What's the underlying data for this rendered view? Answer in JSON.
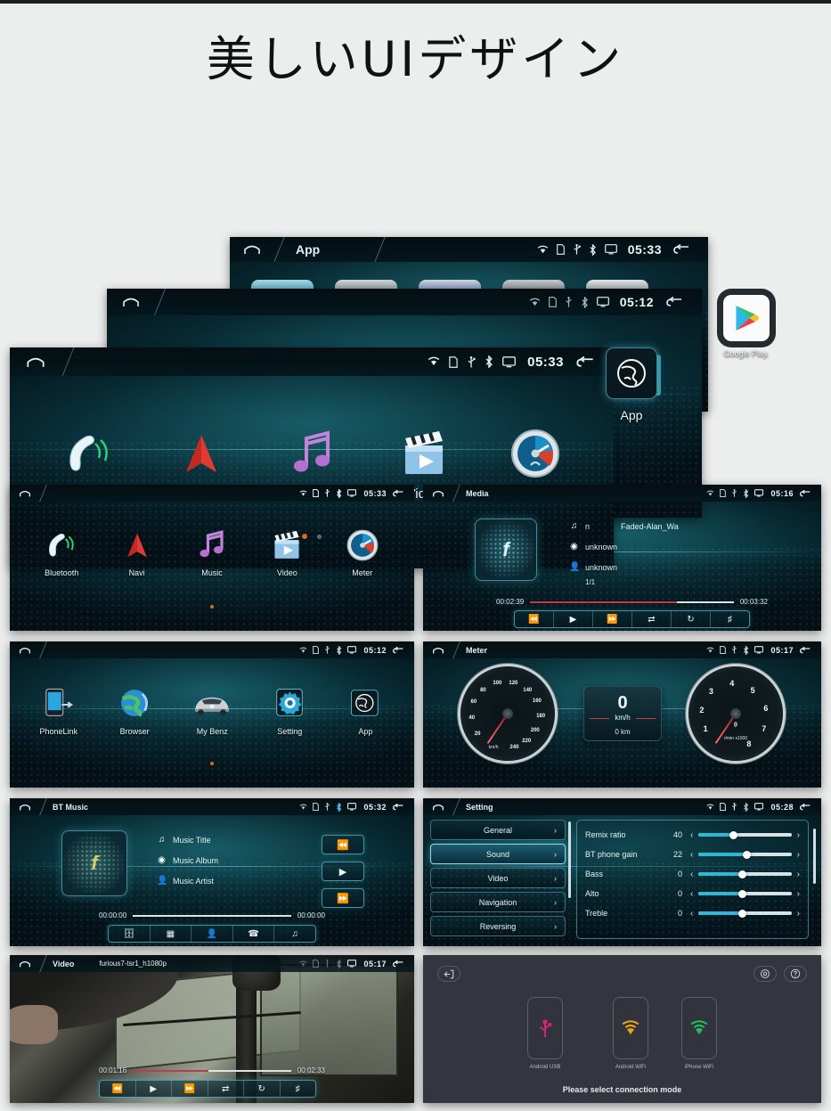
{
  "page": {
    "title": "美しいUIデザイン",
    "background": "#eceded"
  },
  "status_icons": [
    "wifi-icon",
    "sim-card-icon",
    "usb-icon",
    "bluetooth-icon",
    "display-icon"
  ],
  "hero": {
    "app_screen": {
      "title": "App",
      "time": "05:33",
      "google_play_label": "Google Play.",
      "home_icon": "home-icon",
      "back_icon": "back-arrow-icon"
    },
    "menu2_screen": {
      "title": "",
      "time": "05:12",
      "app_label": "App",
      "app_icon": "globe-icon"
    },
    "main_screen": {
      "title": "",
      "time": "05:33",
      "apps": [
        {
          "label": "Bluetooth",
          "icon": "bluetooth-phone-icon"
        },
        {
          "label": "Navi",
          "icon": "navigation-arrow-icon"
        },
        {
          "label": "Music",
          "icon": "music-note-icon"
        },
        {
          "label": "Video",
          "icon": "clapperboard-play-icon"
        },
        {
          "label": "Meter",
          "icon": "gauge-meter-icon"
        }
      ],
      "dots": [
        "on",
        "off"
      ]
    }
  },
  "panels": {
    "home1": {
      "title": "",
      "time": "05:33",
      "apps": [
        {
          "label": "Bluetooth",
          "icon": "bluetooth-phone-icon"
        },
        {
          "label": "Navi",
          "icon": "navigation-arrow-icon"
        },
        {
          "label": "Music",
          "icon": "music-note-icon"
        },
        {
          "label": "Video",
          "icon": "clapperboard-play-icon"
        },
        {
          "label": "Meter",
          "icon": "gauge-meter-icon"
        }
      ]
    },
    "media": {
      "title": "Media",
      "time": "05:16",
      "album_glyph": "f",
      "track_prefix": "n",
      "track_name": "Faded-Alan_Wa",
      "album": "unknown",
      "artist": "unknown",
      "index": "1/1",
      "elapsed": "00:02:39",
      "duration": "00:03:32",
      "progress_percent": 72,
      "controls": [
        "prev-icon",
        "play-icon",
        "next-icon",
        "shuffle-icon",
        "repeat-icon",
        "playlist-icon"
      ]
    },
    "home2": {
      "title": "",
      "time": "05:12",
      "apps": [
        {
          "label": "PhoneLink",
          "icon": "phonelink-icon"
        },
        {
          "label": "Browser",
          "icon": "globe-browser-icon"
        },
        {
          "label": "My Benz",
          "icon": "car-icon"
        },
        {
          "label": "Setting",
          "icon": "gear-icon"
        },
        {
          "label": "App",
          "icon": "globe-app-icon"
        }
      ]
    },
    "meter": {
      "title": "Meter",
      "time": "05:17",
      "speedo": {
        "unit": "km/h",
        "ticks": [
          "20",
          "40",
          "60",
          "80",
          "100",
          "120",
          "140",
          "160",
          "180",
          "200",
          "220",
          "240"
        ],
        "needle_value": 0
      },
      "tacho": {
        "unit": "r/min x1000",
        "ticks": [
          "1",
          "2",
          "3",
          "4",
          "5",
          "6",
          "7",
          "8"
        ],
        "center_value": "0",
        "needle_value": 0
      },
      "center": {
        "speed": "0",
        "unit": "km/h",
        "odo": "0 km"
      }
    },
    "btmusic": {
      "title": "BT Music",
      "time": "05:32",
      "album_glyph": "f",
      "music_title": "Music Title",
      "music_album": "Music Album",
      "music_artist": "Music Artist",
      "elapsed": "00:00:00",
      "duration": "00:00:00",
      "progress_percent": 0,
      "side_controls": [
        "prev-icon",
        "play-icon",
        "next-icon"
      ],
      "bottom_controls": [
        "dialpad-copy-icon",
        "keypad-icon",
        "contacts-icon",
        "call-log-icon",
        "music-icon"
      ]
    },
    "setting": {
      "title": "Setting",
      "time": "05:28",
      "menu": [
        {
          "label": "General",
          "active": false
        },
        {
          "label": "Sound",
          "active": true
        },
        {
          "label": "Video",
          "active": false
        },
        {
          "label": "Navigation",
          "active": false
        },
        {
          "label": "Reversing",
          "active": false
        }
      ],
      "rows": [
        {
          "name": "Remix ratio",
          "value": "40",
          "percent": 38
        },
        {
          "name": "BT phone gain",
          "value": "22",
          "percent": 52
        },
        {
          "name": "Bass",
          "value": "0",
          "percent": 47
        },
        {
          "name": "Alto",
          "value": "0",
          "percent": 47
        },
        {
          "name": "Treble",
          "value": "0",
          "percent": 47
        }
      ],
      "chevron": "›"
    },
    "video": {
      "title": "Video",
      "filename": "furious7-tsr1_h1080p",
      "time": "05:17",
      "elapsed": "00:01:16",
      "duration": "00:02:33",
      "progress_percent": 48,
      "controls": [
        "prev-icon",
        "play-icon",
        "next-icon",
        "shuffle-icon",
        "repeat-icon",
        "playlist-icon"
      ]
    },
    "connection": {
      "back_icon": "exit-icon",
      "gear_icon": "gear-icon",
      "help_icon": "help-icon",
      "modes": [
        {
          "label": "Android USB",
          "icon": "usb-icon",
          "color": "#d6247c"
        },
        {
          "label": "Android WiFi",
          "icon": "wifi-icon",
          "color": "#e8a317"
        },
        {
          "label": "iPhone WiFi",
          "icon": "wifi-icon",
          "color": "#23bd5e"
        }
      ],
      "hint": "Please select connection mode"
    }
  },
  "colors": {
    "accent": "#2fb7d8",
    "progress": "#c03a4a",
    "dot_active": "#d96a10",
    "panel_bg": "#041c24"
  }
}
